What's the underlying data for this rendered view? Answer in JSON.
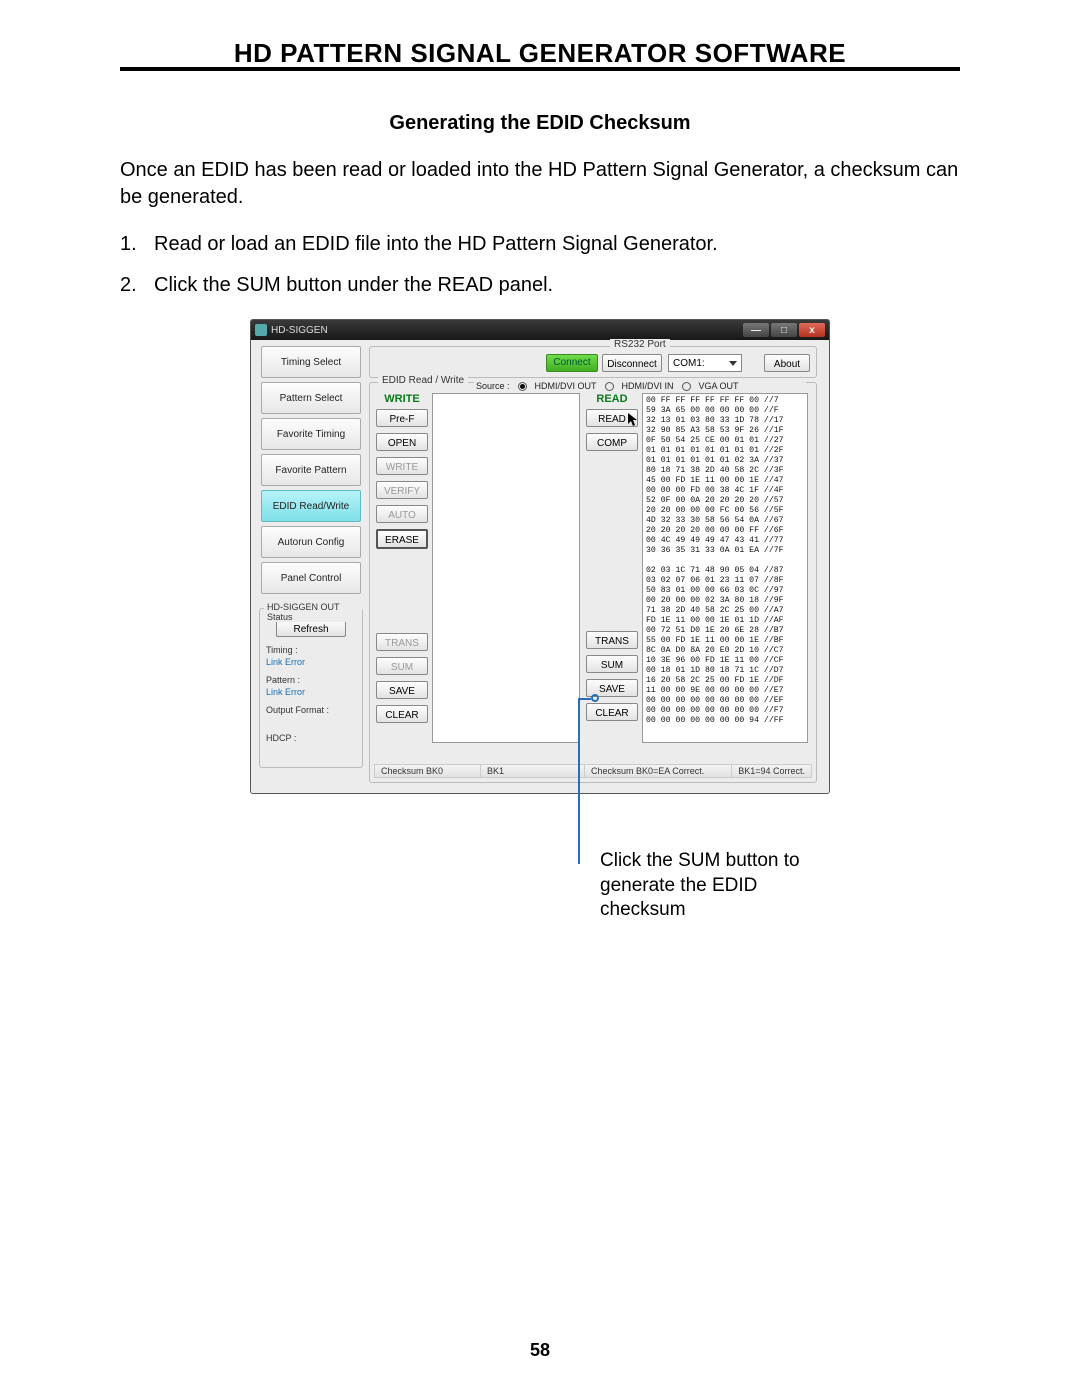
{
  "header": {
    "title": "HD PATTERN SIGNAL GENERATOR SOFTWARE"
  },
  "section": {
    "title": "Generating the EDID Checksum"
  },
  "intro": "Once an EDID has been read or loaded into the HD Pattern Signal Generator, a checksum can be generated.",
  "steps": {
    "n1": "1.",
    "s1": "Read or load an EDID file into the HD Pattern Signal Generator.",
    "n2": "2.",
    "s2": "Click the SUM button under the READ panel."
  },
  "callout": "Click the SUM button to generate the EDID checksum",
  "page_number": "58",
  "win": {
    "title": "HD-SIGGEN",
    "minimize": "—",
    "maximize": "□",
    "close": "x",
    "rs232": {
      "legend": "RS232 Port",
      "connect": "Connect",
      "disconnect": "Disconnect",
      "com": "COM1:",
      "about": "About"
    },
    "sidebar": {
      "items": [
        "Timing Select",
        "Pattern Select",
        "Favorite Timing",
        "Favorite Pattern",
        "EDID Read/Write",
        "Autorun Config",
        "Panel Control"
      ],
      "selected_index": 4
    },
    "status": {
      "legend": "HD-SIGGEN OUT Status",
      "refresh": "Refresh",
      "timing_label": "Timing :",
      "timing_value": "Link Error",
      "pattern_label": "Pattern :",
      "pattern_value": "Link Error",
      "output_label": "Output Format :",
      "hdcp_label": "HDCP :"
    },
    "edid": {
      "legend": "EDID Read / Write",
      "source_label": "Source :",
      "radios": {
        "hdmi_out": "HDMI/DVI OUT",
        "hdmi_in": "HDMI/DVI IN",
        "vga_out": "VGA OUT"
      },
      "write_label": "WRITE",
      "read_label": "READ",
      "left_buttons": {
        "pref": "Pre-F",
        "open": "OPEN",
        "write": "WRITE",
        "verify": "VERIFY",
        "auto": "AUTO",
        "erase": "ERASE",
        "trans": "TRANS",
        "sum": "SUM",
        "save": "SAVE",
        "clear": "CLEAR"
      },
      "right_buttons": {
        "read": "READ",
        "comp": "COMP",
        "trans": "TRANS",
        "sum": "SUM",
        "save": "SAVE",
        "clear": "CLEAR"
      },
      "footer": {
        "left_bk0": "Checksum BK0",
        "left_bk1": "BK1",
        "right_bk0": "Checksum BK0=EA Correct.",
        "right_bk1": "BK1=94 Correct."
      },
      "hex_dump": "00 FF FF FF FF FF FF 00 //7\n59 3A 65 00 00 00 00 00 //F\n32 13 01 03 80 33 1D 78 //17\n32 90 85 A3 58 53 9F 26 //1F\n0F 50 54 25 CE 00 01 01 //27\n01 01 01 01 01 01 01 01 //2F\n01 01 01 01 01 01 02 3A //37\n80 18 71 38 2D 40 58 2C //3F\n45 00 FD 1E 11 00 00 1E //47\n00 00 00 FD 00 38 4C 1F //4F\n52 0F 00 0A 20 20 20 20 //57\n20 20 00 00 00 FC 00 56 //5F\n4D 32 33 30 58 56 54 0A //67\n20 20 20 20 00 00 00 FF //6F\n00 4C 49 49 49 47 43 41 //77\n30 36 35 31 33 0A 01 EA //7F\n\n02 03 1C 71 48 90 05 04 //87\n03 02 07 06 01 23 11 07 //8F\n50 83 01 00 00 66 03 0C //97\n00 20 00 00 02 3A 80 18 //9F\n71 38 2D 40 58 2C 25 00 //A7\nFD 1E 11 00 00 1E 01 1D //AF\n00 72 51 D0 1E 20 6E 28 //B7\n55 00 FD 1E 11 00 00 1E //BF\n8C 0A D0 8A 20 E0 2D 10 //C7\n10 3E 96 00 FD 1E 11 00 //CF\n00 18 01 1D 80 18 71 1C //D7\n16 20 58 2C 25 00 FD 1E //DF\n11 00 00 9E 00 00 00 00 //E7\n00 00 00 00 00 00 00 00 //EF\n00 00 00 00 00 00 00 00 //F7\n00 00 00 00 00 00 00 94 //FF"
    }
  }
}
